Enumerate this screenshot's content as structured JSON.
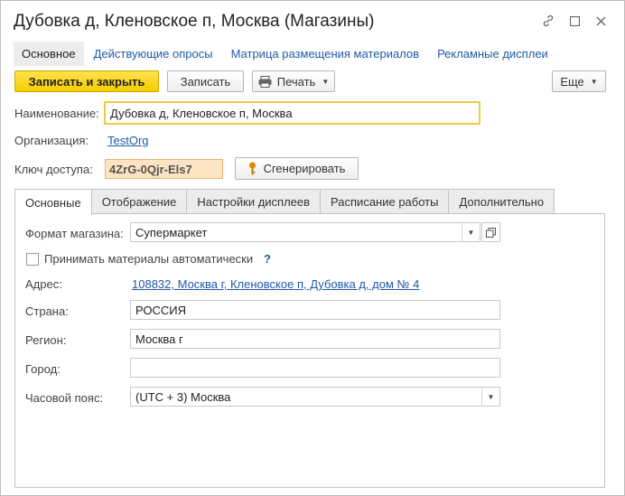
{
  "window": {
    "title": "Дубовка д, Кленовское п, Москва (Магазины)",
    "link_icon": "link-icon",
    "maximize_icon": "maximize-icon",
    "close_icon": "close-icon"
  },
  "nav_tabs": [
    {
      "label": "Основное",
      "active": true
    },
    {
      "label": "Действующие опросы",
      "active": false
    },
    {
      "label": "Матрица размещения материалов",
      "active": false
    },
    {
      "label": "Рекламные дисплеи",
      "active": false
    }
  ],
  "toolbar": {
    "save_close": "Записать и закрыть",
    "save": "Записать",
    "print": "Печать",
    "more": "Еще"
  },
  "form": {
    "name_label": "Наименование:",
    "name_value": "Дубовка д, Кленовское п, Москва",
    "org_label": "Организация:",
    "org_value": "TestOrg",
    "key_label": "Ключ доступа:",
    "key_value": "4ZrG-0Qjr-Els7",
    "generate": "Сгенерировать"
  },
  "tabs": [
    {
      "label": "Основные",
      "active": true
    },
    {
      "label": "Отображение",
      "active": false
    },
    {
      "label": "Настройки дисплеев",
      "active": false
    },
    {
      "label": "Расписание работы",
      "active": false
    },
    {
      "label": "Дополнительно",
      "active": false
    }
  ],
  "panel": {
    "format_label": "Формат магазина:",
    "format_value": "Супермаркет",
    "auto_label": "Принимать материалы автоматически",
    "auto_checked": false,
    "help": "?",
    "address_label": "Адрес:",
    "address_value": "108832, Москва г, Кленовское п, Дубовка д, дом № 4",
    "country_label": "Страна:",
    "country_value": "РОССИЯ",
    "region_label": "Регион:",
    "region_value": "Москва г",
    "city_label": "Город:",
    "city_value": "",
    "tz_label": "Часовой пояс:",
    "tz_value": "(UTC + 3) Москва"
  },
  "colors": {
    "accent": "#f5cd00",
    "link": "#1f5aa6",
    "key_bg": "#fce4c2"
  }
}
